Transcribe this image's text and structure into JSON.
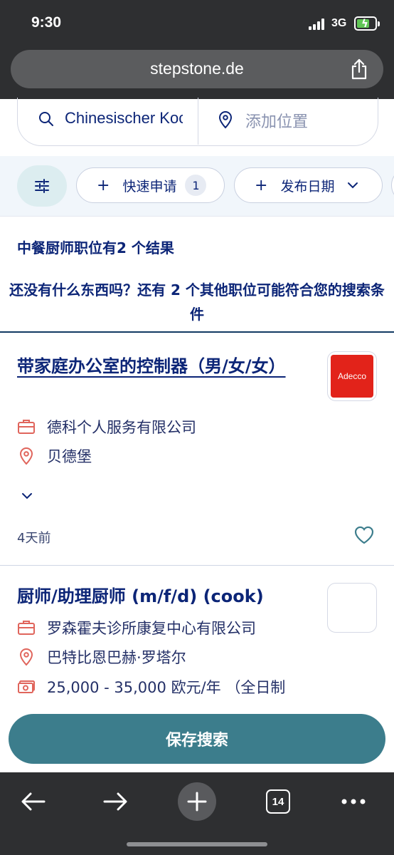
{
  "status_bar": {
    "time": "9:30",
    "network": "3G"
  },
  "browser": {
    "url": "stepstone.de",
    "tabs_count": "14"
  },
  "search": {
    "query": "Chinesischer Koch",
    "location_placeholder": "添加位置"
  },
  "filters": {
    "quick_apply": {
      "label": "快速申请",
      "count": "1"
    },
    "date_posted": {
      "label": "发布日期"
    }
  },
  "results": {
    "count_text": "中餐厨师职位有2 个结果",
    "more_text": "还没有什么东西吗？还有 2 个其他职位可能符合您的搜索条件"
  },
  "jobs": [
    {
      "title": "带家庭办公室的控制器（男/女/女）",
      "company": "德科个人服务有限公司",
      "location": "贝德堡",
      "posted": "4天前",
      "logo_text": "Adecco"
    },
    {
      "title": "厨师/助理厨师 (m/f/d) (cook)",
      "company": "罗森霍夫诊所康复中心有限公司",
      "location": "巴特比恩巴赫·罗塔尔",
      "salary": "25,000 - 35,000 欧元/年 （全日制"
    }
  ],
  "save_search_label": "保存搜索",
  "colors": {
    "brand_navy": "#0c2577",
    "teal": "#3c7d8c",
    "icon_red": "#e0655c",
    "chrome_dark": "#2e2f31"
  }
}
